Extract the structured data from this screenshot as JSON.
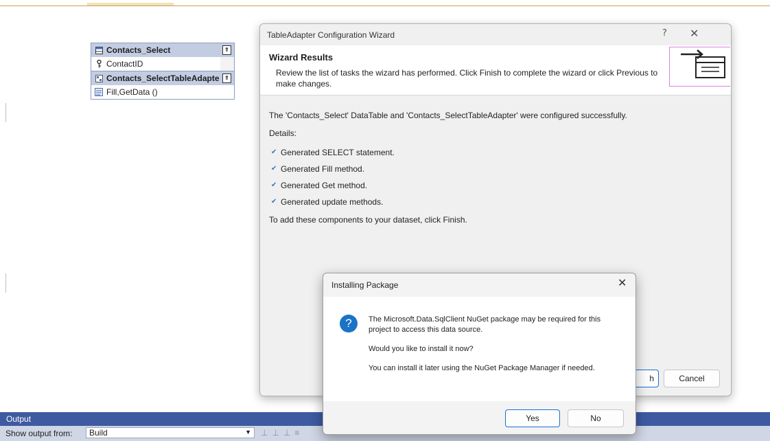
{
  "designer": {
    "table": {
      "name": "Contacts_Select",
      "column": "ContactID",
      "adapter_name": "Contacts_SelectTableAdapte",
      "method": "Fill,GetData ()"
    }
  },
  "wizard": {
    "title": "TableAdapter Configuration Wizard",
    "help_label": "?",
    "close_label": "✕",
    "header_title": "Wizard Results",
    "header_desc": "Review the list of tasks the wizard has performed. Click Finish to complete the wizard or click Previous to make changes.",
    "summary": "The 'Contacts_Select' DataTable and 'Contacts_SelectTableAdapter' were configured successfully.",
    "details_label": "Details:",
    "tasks": [
      "Generated SELECT statement.",
      "Generated Fill method.",
      "Generated Get method.",
      "Generated update methods."
    ],
    "footer_note": "To add these components to your dataset, click Finish.",
    "finish_partial": "h",
    "cancel_label": "Cancel"
  },
  "install_dialog": {
    "title": "Installing Package",
    "close_label": "✕",
    "icon_glyph": "?",
    "message": "The Microsoft.Data.SqlClient NuGet package may be required for this project to access this data source.",
    "question": "Would you like to install it now?",
    "hint": "You can install it later using the NuGet Package Manager if needed.",
    "yes_label": "Yes",
    "no_label": "No"
  },
  "output": {
    "title": "Output",
    "show_label": "Show output from:",
    "source": "Build"
  },
  "icons": {
    "table": "table-icon",
    "key": "key-icon",
    "adapter": "adapter-icon",
    "method": "method-icon",
    "question": "question-icon"
  },
  "colors": {
    "accent": "#1a6fd1",
    "output_header": "#3e5aa1",
    "table_header": "#c3cde2"
  }
}
